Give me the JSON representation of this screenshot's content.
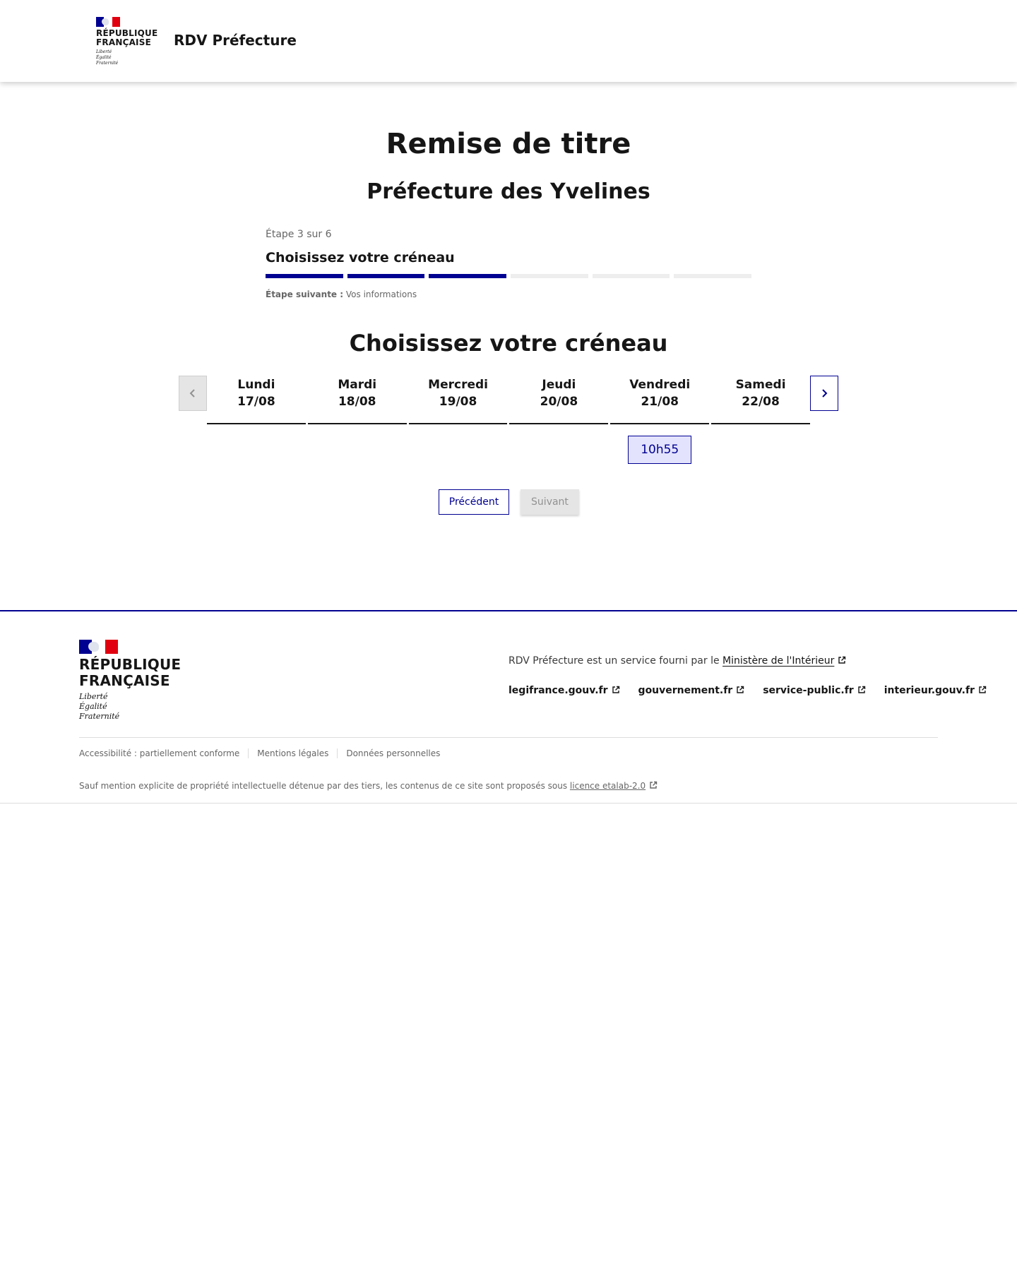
{
  "header": {
    "logo": {
      "line1": "RÉPUBLIQUE",
      "line2": "FRANÇAISE",
      "motto1": "Liberté",
      "motto2": "Égalité",
      "motto3": "Fraternité"
    },
    "service_name": "RDV Préfecture"
  },
  "main": {
    "title": "Remise de titre",
    "subtitle": "Préfecture des Yvelines",
    "stepper": {
      "state": "Étape 3 sur 6",
      "title": "Choisissez votre créneau",
      "current": 3,
      "total": 6,
      "next_label": "Étape suivante :",
      "next_value": "Vos informations"
    },
    "section_title": "Choisissez votre créneau",
    "calendar": {
      "days": [
        {
          "name": "Lundi",
          "date": "17/08",
          "slots": []
        },
        {
          "name": "Mardi",
          "date": "18/08",
          "slots": []
        },
        {
          "name": "Mercredi",
          "date": "19/08",
          "slots": []
        },
        {
          "name": "Jeudi",
          "date": "20/08",
          "slots": []
        },
        {
          "name": "Vendredi",
          "date": "21/08",
          "slots": [
            "10h55"
          ]
        },
        {
          "name": "Samedi",
          "date": "22/08",
          "slots": []
        }
      ]
    },
    "actions": {
      "previous": "Précédent",
      "next": "Suivant"
    }
  },
  "footer": {
    "logo": {
      "line1": "RÉPUBLIQUE",
      "line2": "FRANÇAISE",
      "motto1": "Liberté",
      "motto2": "Égalité",
      "motto3": "Fraternité"
    },
    "description_prefix": "RDV Préfecture est un service fourni par le ",
    "description_link": "Ministère de l'Intérieur",
    "links": [
      "legifrance.gouv.fr",
      "gouvernement.fr",
      "service-public.fr",
      "interieur.gouv.fr"
    ],
    "bottom_links": [
      "Accessibilité : partiellement conforme",
      "Mentions légales",
      "Données personnelles"
    ],
    "license_prefix": "Sauf mention explicite de propriété intellectuelle détenue par des tiers, les contenus de ce site sont proposés sous ",
    "license_link": "licence etalab-2.0"
  },
  "colors": {
    "accent": "#000091",
    "slot_bg": "#e3e3fd",
    "flag_red": "#e1000f",
    "disabled_bg": "#e5e5e5"
  },
  "icons": {
    "prev": "chevron-left-icon",
    "next": "chevron-right-icon",
    "external": "external-link-icon"
  }
}
